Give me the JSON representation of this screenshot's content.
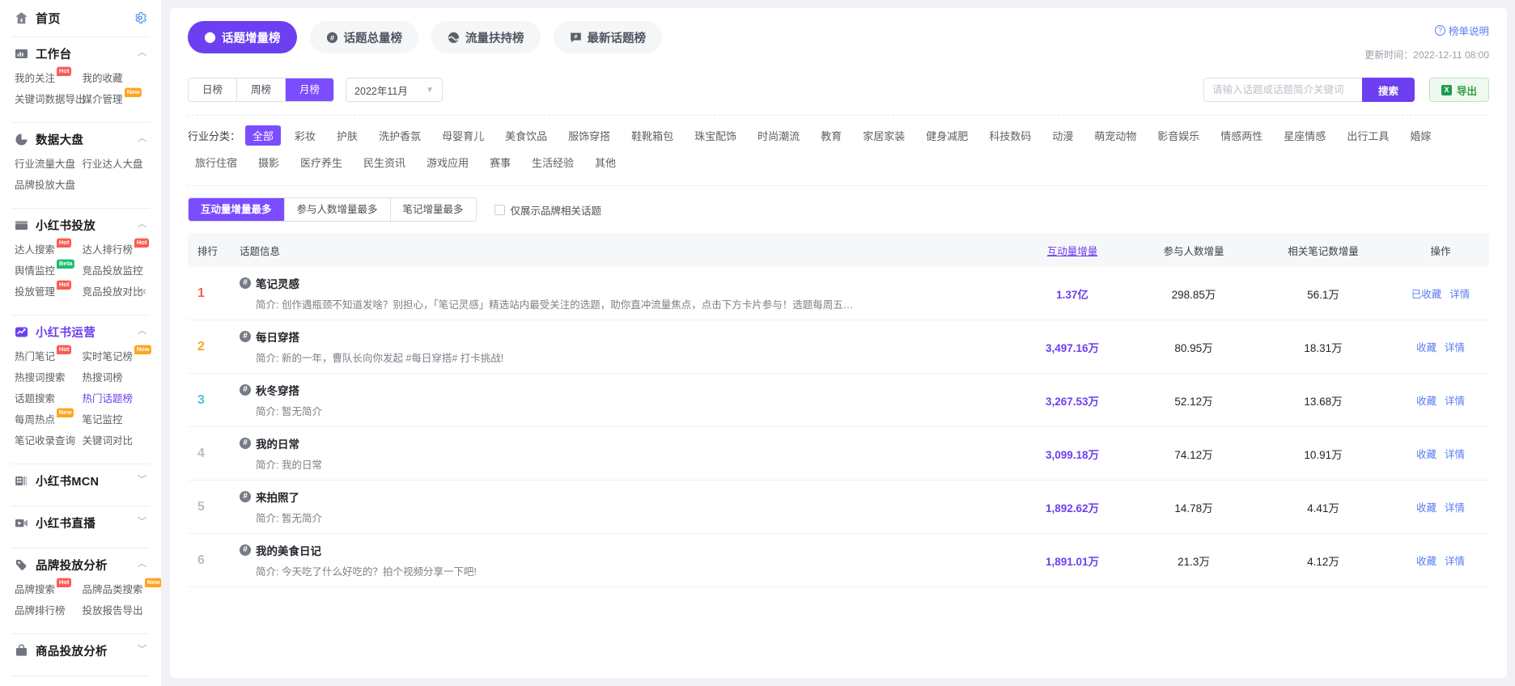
{
  "sidebar": {
    "home": {
      "label": "首页",
      "icon": "home-icon",
      "settings_icon": "gear-icon"
    },
    "groups": [
      {
        "label": "工作台",
        "icon": "dashboard-icon",
        "expanded": true,
        "links": [
          {
            "label": "我的关注",
            "badge": "Hot",
            "badge_type": "hot"
          },
          {
            "label": "我的收藏",
            "badge": "",
            "badge_type": ""
          },
          {
            "label": "关键词数据导出",
            "badge": "",
            "badge_type": ""
          },
          {
            "label": "媒介管理",
            "badge": "New",
            "badge_type": "new"
          }
        ]
      },
      {
        "label": "数据大盘",
        "icon": "pie-icon",
        "expanded": true,
        "links": [
          {
            "label": "行业流量大盘",
            "badge": "",
            "badge_type": ""
          },
          {
            "label": "行业达人大盘",
            "badge": "",
            "badge_type": ""
          },
          {
            "label": "品牌投放大盘",
            "badge": "",
            "badge_type": ""
          }
        ]
      },
      {
        "label": "小红书投放",
        "icon": "folder-icon",
        "expanded": true,
        "links": [
          {
            "label": "达人搜索",
            "badge": "Hot",
            "badge_type": "hot"
          },
          {
            "label": "达人排行榜",
            "badge": "Hot",
            "badge_type": "hot"
          },
          {
            "label": "舆情监控",
            "badge": "Beta",
            "badge_type": "beta"
          },
          {
            "label": "竞品投放监控",
            "badge": "",
            "badge_type": ""
          },
          {
            "label": "投放管理",
            "badge": "Hot",
            "badge_type": "hot"
          },
          {
            "label": "竞品投放对比",
            "badge": "",
            "badge_type": ""
          }
        ]
      },
      {
        "label": "小红书运营",
        "icon": "chart-icon",
        "expanded": true,
        "active": true,
        "links": [
          {
            "label": "热门笔记",
            "badge": "Hot",
            "badge_type": "hot"
          },
          {
            "label": "实时笔记榜",
            "badge": "New",
            "badge_type": "new"
          },
          {
            "label": "热搜词搜索",
            "badge": "",
            "badge_type": ""
          },
          {
            "label": "热搜词榜",
            "badge": "",
            "badge_type": ""
          },
          {
            "label": "话题搜索",
            "badge": "",
            "badge_type": ""
          },
          {
            "label": "热门话题榜",
            "badge": "",
            "badge_type": "",
            "highlight": true
          },
          {
            "label": "每周热点",
            "badge": "New",
            "badge_type": "new"
          },
          {
            "label": "笔记监控",
            "badge": "",
            "badge_type": ""
          },
          {
            "label": "笔记收录查询",
            "badge": "",
            "badge_type": ""
          },
          {
            "label": "关键词对比",
            "badge": "",
            "badge_type": ""
          }
        ]
      },
      {
        "label": "小红书MCN",
        "icon": "mcn-icon",
        "expanded": false,
        "links": []
      },
      {
        "label": "小红书直播",
        "icon": "video-icon",
        "expanded": false,
        "links": []
      },
      {
        "label": "品牌投放分析",
        "icon": "tag-icon",
        "expanded": true,
        "links": [
          {
            "label": "品牌搜索",
            "badge": "Hot",
            "badge_type": "hot"
          },
          {
            "label": "品牌品类搜索",
            "badge": "New",
            "badge_type": "new"
          },
          {
            "label": "品牌排行榜",
            "badge": "",
            "badge_type": ""
          },
          {
            "label": "投放报告导出",
            "badge": "",
            "badge_type": ""
          }
        ]
      },
      {
        "label": "商品投放分析",
        "icon": "bag-icon",
        "expanded": false,
        "links": []
      }
    ],
    "collapse_icon": "«"
  },
  "header": {
    "tabs": [
      {
        "label": "话题增量榜",
        "icon": "arrow-up-circle-icon",
        "active": true
      },
      {
        "label": "话题总量榜",
        "icon": "hash-circle-icon",
        "active": false
      },
      {
        "label": "流量扶持榜",
        "icon": "traffic-icon",
        "active": false
      },
      {
        "label": "最新话题榜",
        "icon": "message-icon",
        "active": false
      }
    ],
    "rank_desc": "榜单说明",
    "rank_desc_icon": "question-circle-icon",
    "update_time": "更新时间：2022-12-11 08:00"
  },
  "filters": {
    "period_tabs": [
      {
        "label": "日榜",
        "active": false
      },
      {
        "label": "周榜",
        "active": false
      },
      {
        "label": "月榜",
        "active": true
      }
    ],
    "month_value": "2022年11月",
    "month_chevron": "chevron-down-icon",
    "search_placeholder": "请输入话题或话题简介关键词",
    "search_value": "",
    "search_button": "搜索",
    "export_button": "导出",
    "export_icon": "excel-icon"
  },
  "industry": {
    "label": "行业分类：",
    "items": [
      {
        "label": "全部",
        "active": true
      },
      {
        "label": "彩妆",
        "active": false
      },
      {
        "label": "护肤",
        "active": false
      },
      {
        "label": "洗护香氛",
        "active": false
      },
      {
        "label": "母婴育儿",
        "active": false
      },
      {
        "label": "美食饮品",
        "active": false
      },
      {
        "label": "服饰穿搭",
        "active": false
      },
      {
        "label": "鞋靴箱包",
        "active": false
      },
      {
        "label": "珠宝配饰",
        "active": false
      },
      {
        "label": "时尚潮流",
        "active": false
      },
      {
        "label": "教育",
        "active": false
      },
      {
        "label": "家居家装",
        "active": false
      },
      {
        "label": "健身减肥",
        "active": false
      },
      {
        "label": "科技数码",
        "active": false
      },
      {
        "label": "动漫",
        "active": false
      },
      {
        "label": "萌宠动物",
        "active": false
      },
      {
        "label": "影音娱乐",
        "active": false
      },
      {
        "label": "情感两性",
        "active": false
      },
      {
        "label": "星座情感",
        "active": false
      },
      {
        "label": "出行工具",
        "active": false
      },
      {
        "label": "婚嫁",
        "active": false
      },
      {
        "label": "旅行住宿",
        "active": false
      },
      {
        "label": "摄影",
        "active": false
      },
      {
        "label": "医疗养生",
        "active": false
      },
      {
        "label": "民生资讯",
        "active": false
      },
      {
        "label": "游戏应用",
        "active": false
      },
      {
        "label": "赛事",
        "active": false
      },
      {
        "label": "生活经验",
        "active": false
      },
      {
        "label": "其他",
        "active": false
      }
    ]
  },
  "sort": {
    "tabs": [
      {
        "label": "互动量增量最多",
        "active": true
      },
      {
        "label": "参与人数增量最多",
        "active": false
      },
      {
        "label": "笔记增量最多",
        "active": false
      }
    ],
    "checkbox_label": "仅展示品牌相关话题",
    "checkbox_checked": false
  },
  "table": {
    "columns": {
      "rank": "排行",
      "info": "话题信息",
      "interaction": "互动量增量",
      "participants": "参与人数增量",
      "notes": "相关笔记数增量",
      "ops": "操作"
    },
    "rows": [
      {
        "rank": "1",
        "title": "笔记灵感",
        "desc": "简介: 创作遇瓶颈不知道发啥？别担心，「笔记灵感」精选站内最受关注的选题，助你直冲流量焦点，点击下方卡片参与！选题每周五更新，记得常来get最新选题～",
        "interaction": "1.37亿",
        "participants": "298.85万",
        "notes": "56.1万",
        "ops": [
          "已收藏",
          "详情"
        ]
      },
      {
        "rank": "2",
        "title": "每日穿搭",
        "desc": "简介: 新的一年，曹队长向你发起 #每日穿搭# 打卡挑战!",
        "interaction": "3,497.16万",
        "participants": "80.95万",
        "notes": "18.31万",
        "ops": [
          "收藏",
          "详情"
        ]
      },
      {
        "rank": "3",
        "title": "秋冬穿搭",
        "desc": "简介: 暂无简介",
        "interaction": "3,267.53万",
        "participants": "52.12万",
        "notes": "13.68万",
        "ops": [
          "收藏",
          "详情"
        ]
      },
      {
        "rank": "4",
        "title": "我的日常",
        "desc": "简介: 我的日常",
        "interaction": "3,099.18万",
        "participants": "74.12万",
        "notes": "10.91万",
        "ops": [
          "收藏",
          "详情"
        ]
      },
      {
        "rank": "5",
        "title": "来拍照了",
        "desc": "简介: 暂无简介",
        "interaction": "1,892.62万",
        "participants": "14.78万",
        "notes": "4.41万",
        "ops": [
          "收藏",
          "详情"
        ]
      },
      {
        "rank": "6",
        "title": "我的美食日记",
        "desc": "简介: 今天吃了什么好吃的？拍个视频分享一下吧!",
        "interaction": "1,891.01万",
        "participants": "21.3万",
        "notes": "4.12万",
        "ops": [
          "收藏",
          "详情"
        ]
      }
    ]
  },
  "colors": {
    "accent": "#6c3ff0",
    "accent_light": "#7c4dff",
    "link": "#5a7bf5",
    "hot": "#fb5b52",
    "new": "#ffa420",
    "beta": "#19be6b",
    "rank1": "#fb5b52",
    "rank2": "#f5a623",
    "rank3": "#4ec6d6"
  }
}
